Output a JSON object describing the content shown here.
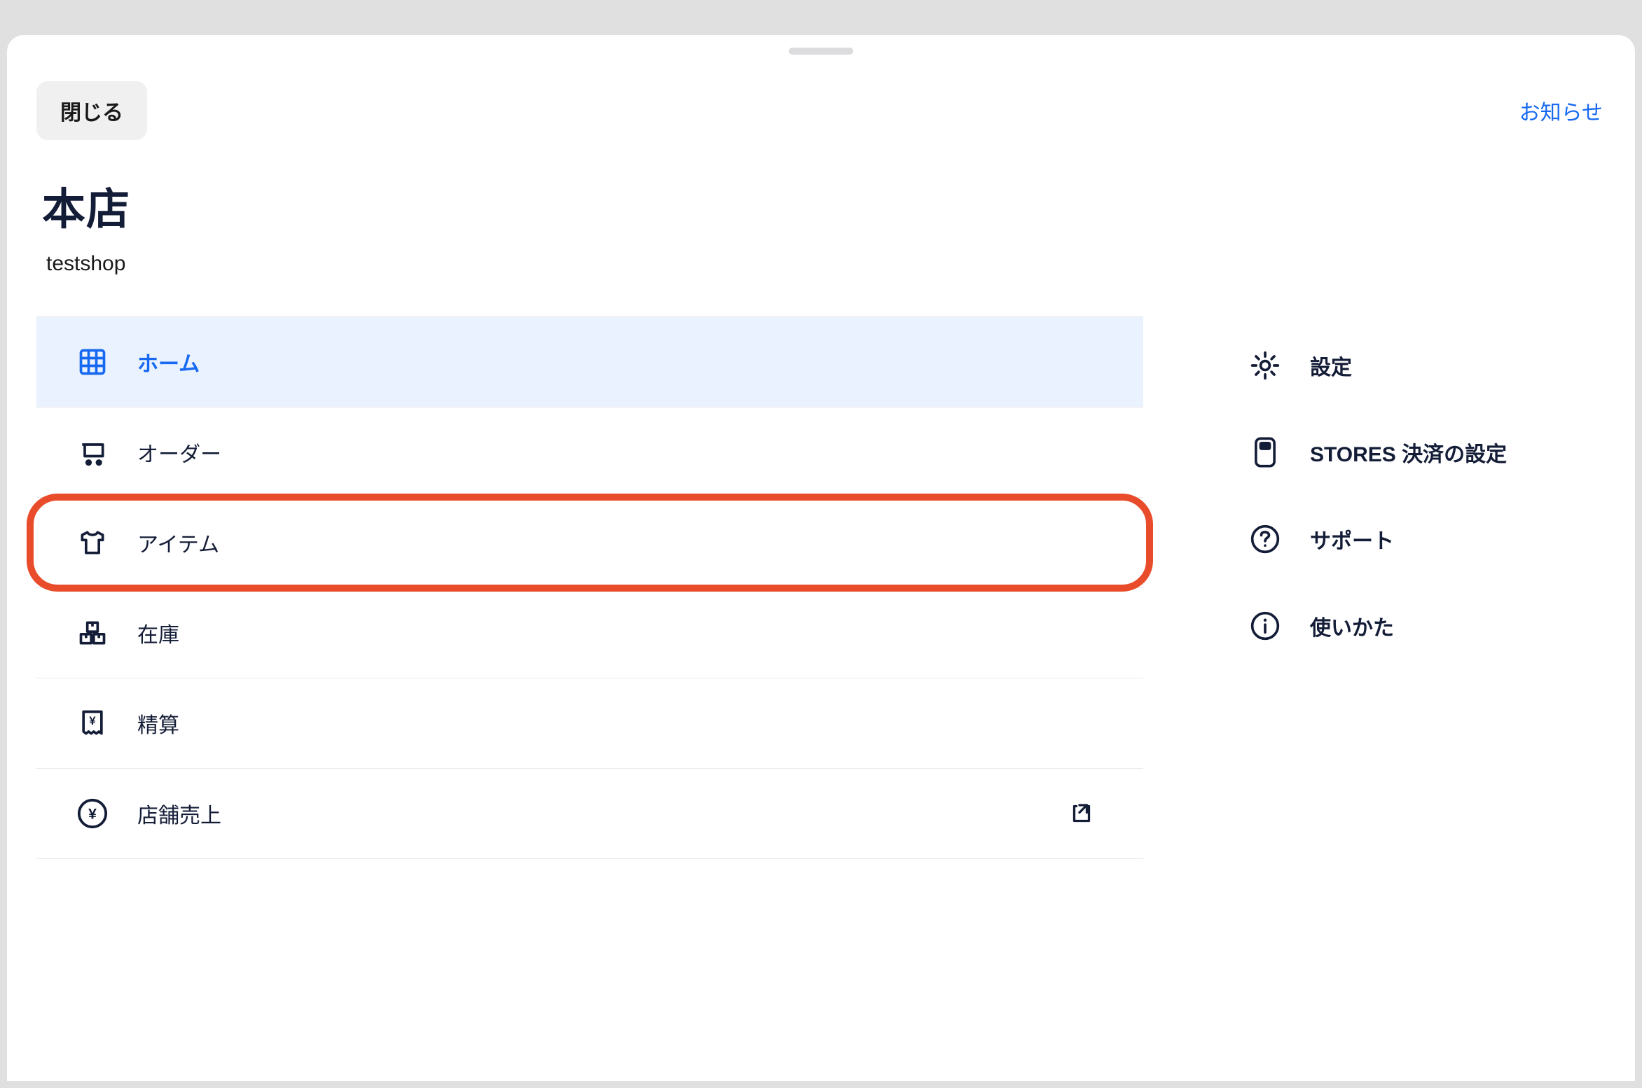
{
  "header": {
    "close_label": "閉じる",
    "notifications_label": "お知らせ"
  },
  "title": "本店",
  "subtitle": "testshop",
  "menu": {
    "items": [
      {
        "id": "home",
        "label": "ホーム",
        "icon": "grid-icon",
        "active": true,
        "external": false,
        "highlighted": false
      },
      {
        "id": "order",
        "label": "オーダー",
        "icon": "cart-icon",
        "active": false,
        "external": false,
        "highlighted": false
      },
      {
        "id": "item",
        "label": "アイテム",
        "icon": "shirt-icon",
        "active": false,
        "external": false,
        "highlighted": true
      },
      {
        "id": "stock",
        "label": "在庫",
        "icon": "boxes-icon",
        "active": false,
        "external": false,
        "highlighted": false
      },
      {
        "id": "settlement",
        "label": "精算",
        "icon": "receipt-icon",
        "active": false,
        "external": false,
        "highlighted": false
      },
      {
        "id": "store-sales",
        "label": "店舗売上",
        "icon": "yen-circle-icon",
        "active": false,
        "external": true,
        "highlighted": false
      }
    ]
  },
  "side_menu": {
    "items": [
      {
        "id": "settings",
        "label": "設定",
        "icon": "gear-icon"
      },
      {
        "id": "stores-payment",
        "label": "STORES 決済の設定",
        "icon": "terminal-icon"
      },
      {
        "id": "support",
        "label": "サポート",
        "icon": "help-icon"
      },
      {
        "id": "howto",
        "label": "使いかた",
        "icon": "info-icon"
      }
    ]
  },
  "colors": {
    "primary": "#1669f0",
    "dark": "#141d37",
    "highlight": "#e84c2a",
    "active_bg": "#eaf2ff"
  }
}
